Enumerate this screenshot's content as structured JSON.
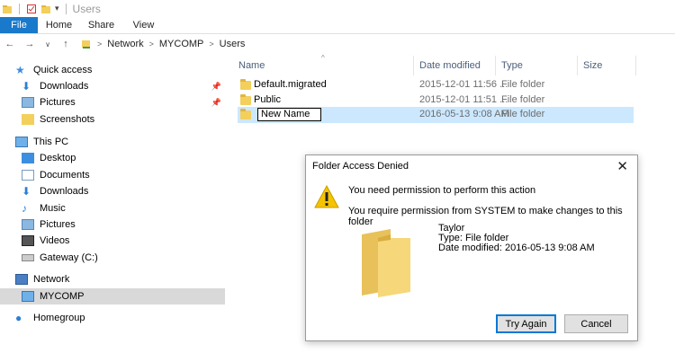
{
  "window": {
    "title": "Users"
  },
  "ribbon": {
    "tabs": [
      "File",
      "Home",
      "Share",
      "View"
    ]
  },
  "address": {
    "crumbs": [
      "Network",
      "MYCOMP",
      "Users"
    ]
  },
  "nav": {
    "items": [
      {
        "label": "Quick access"
      },
      {
        "label": "Downloads"
      },
      {
        "label": "Pictures"
      },
      {
        "label": "Screenshots"
      },
      {
        "label": "This PC"
      },
      {
        "label": "Desktop"
      },
      {
        "label": "Documents"
      },
      {
        "label": "Downloads"
      },
      {
        "label": "Music"
      },
      {
        "label": "Pictures"
      },
      {
        "label": "Videos"
      },
      {
        "label": "Gateway (C:)"
      },
      {
        "label": "Network"
      },
      {
        "label": "MYCOMP"
      },
      {
        "label": "Homegroup"
      }
    ]
  },
  "files": {
    "columns": {
      "name": "Name",
      "date": "Date modified",
      "type": "Type",
      "size": "Size"
    },
    "rows": [
      {
        "name": "Default.migrated",
        "date": "2015-12-01 11:56 ...",
        "type": "File folder"
      },
      {
        "name": "Public",
        "date": "2015-12-01 11:51 ...",
        "type": "File folder"
      },
      {
        "name": "New Name",
        "date": "2016-05-13 9:08 AM",
        "type": "File folder"
      }
    ]
  },
  "dialog": {
    "title": "Folder Access Denied",
    "close": "✕",
    "message1": "You need permission to perform this action",
    "message2": "You require permission from SYSTEM to make changes to this folder",
    "folder_name": "Taylor",
    "folder_type": "Type: File folder",
    "folder_date": "Date modified: 2016-05-13 9:08 AM",
    "try_again": "Try Again",
    "cancel": "Cancel"
  }
}
